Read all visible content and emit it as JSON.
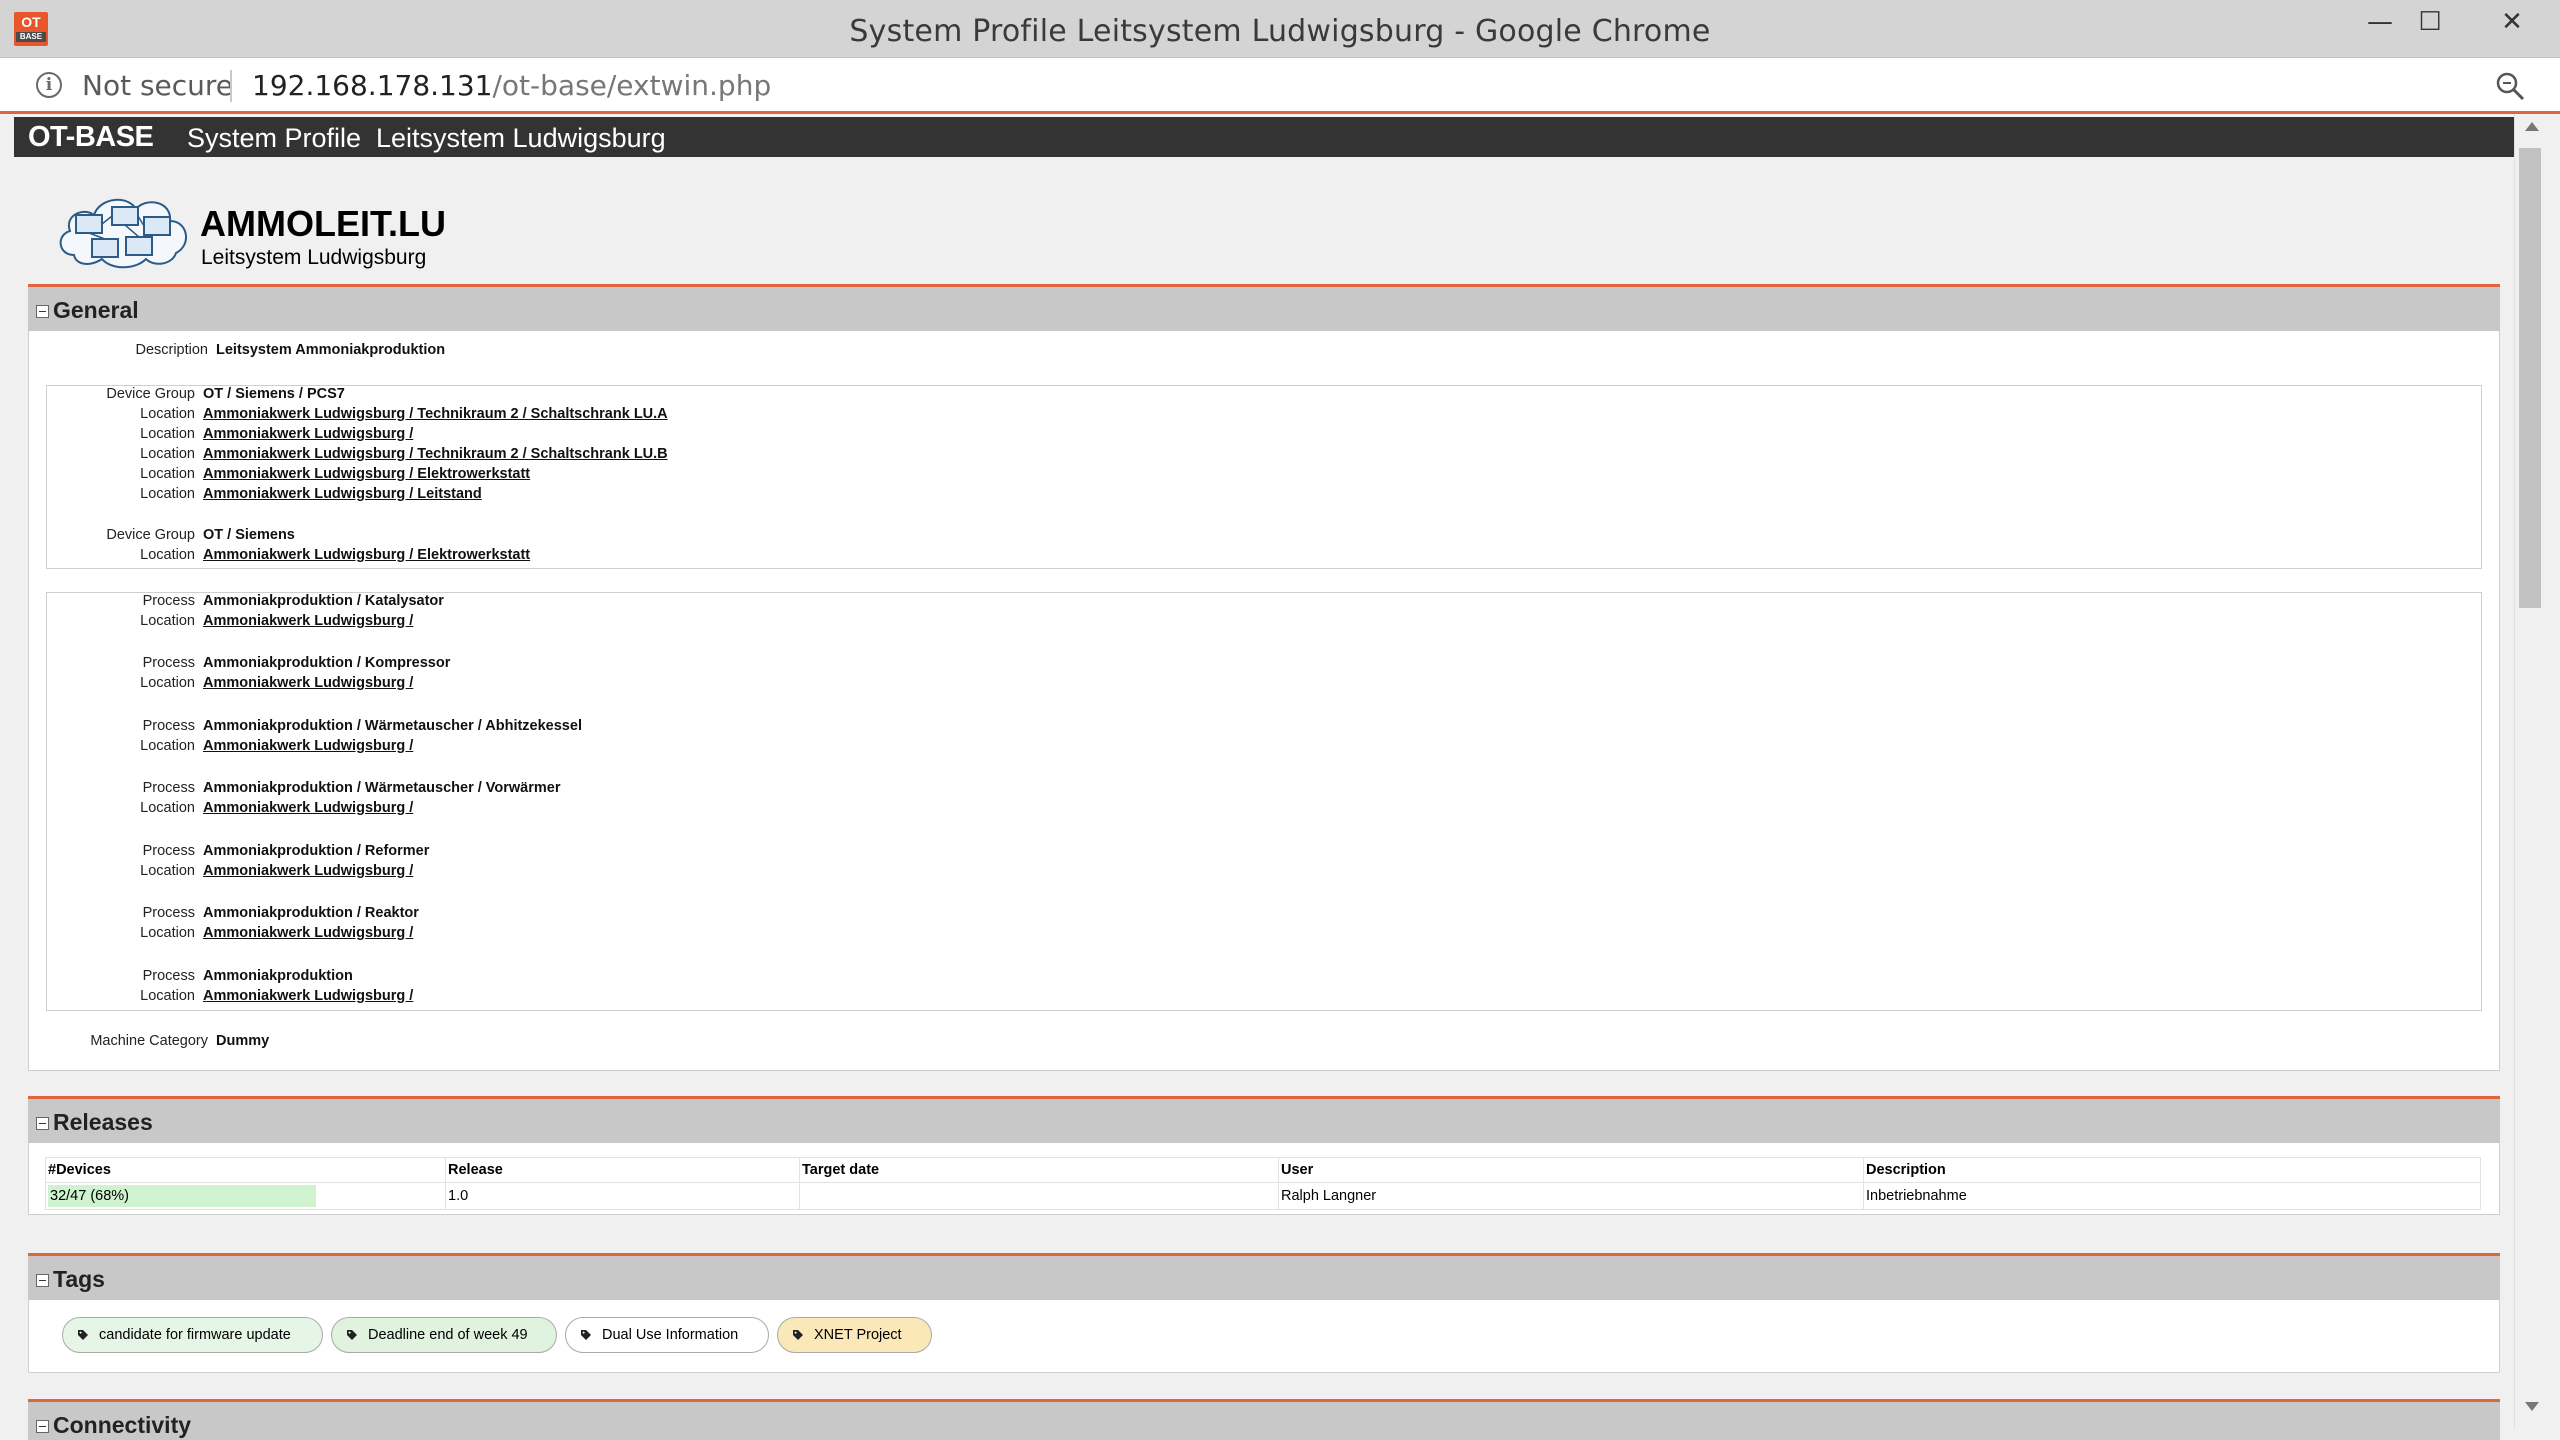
{
  "browser": {
    "window_title": "System Profile Leitsystem Ludwigsburg - Google Chrome",
    "app_icon_text": "OT",
    "app_icon_sub": "BASE",
    "minimize": "—",
    "maximize": "☐",
    "close": "✕",
    "security_label": "Not secure",
    "url_host": "192.168.178.131",
    "url_path": "/ot-base/extwin.php"
  },
  "topbar": {
    "brand": "OT-BASE",
    "crumb_1": "System Profile",
    "crumb_2": "Leitsystem Ludwigsburg"
  },
  "header": {
    "system_name": "AMMOLEIT.LU",
    "system_subtitle": "Leitsystem Ludwigsburg"
  },
  "general": {
    "title": "General",
    "description_label": "Description",
    "description_value": "Leitsystem Ammoniakproduktion",
    "device_groups": [
      {
        "label": "Device Group",
        "value": "OT / Siemens / PCS7",
        "locations": [
          "Ammoniakwerk Ludwigsburg / Technikraum 2 / Schaltschrank LU.A",
          "Ammoniakwerk Ludwigsburg /",
          "Ammoniakwerk Ludwigsburg / Technikraum 2 / Schaltschrank LU.B",
          "Ammoniakwerk Ludwigsburg / Elektrowerkstatt",
          "Ammoniakwerk Ludwigsburg / Leitstand"
        ]
      },
      {
        "label": "Device Group",
        "value": "OT / Siemens",
        "locations": [
          "Ammoniakwerk Ludwigsburg / Elektrowerkstatt"
        ]
      }
    ],
    "location_label": "Location",
    "process_label": "Process",
    "processes": [
      {
        "process": "Ammoniakproduktion / Katalysator",
        "location": "Ammoniakwerk Ludwigsburg /"
      },
      {
        "process": "Ammoniakproduktion / Kompressor",
        "location": "Ammoniakwerk Ludwigsburg /"
      },
      {
        "process": "Ammoniakproduktion / Wärmetauscher / Abhitzekessel",
        "location": "Ammoniakwerk Ludwigsburg /"
      },
      {
        "process": "Ammoniakproduktion / Wärmetauscher / Vorwärmer",
        "location": "Ammoniakwerk Ludwigsburg /"
      },
      {
        "process": "Ammoniakproduktion / Reformer",
        "location": "Ammoniakwerk Ludwigsburg /"
      },
      {
        "process": "Ammoniakproduktion / Reaktor",
        "location": "Ammoniakwerk Ludwigsburg /"
      },
      {
        "process": "Ammoniakproduktion",
        "location": "Ammoniakwerk Ludwigsburg /"
      }
    ],
    "machine_category_label": "Machine Category",
    "machine_category_value": "Dummy"
  },
  "releases": {
    "title": "Releases",
    "columns": [
      "#Devices",
      "Release",
      "Target date",
      "User",
      "Description"
    ],
    "rows": [
      {
        "devices": "32/47 (68%)",
        "devices_fraction": 0.68,
        "release": "1.0",
        "target_date": "",
        "user": "Ralph Langner",
        "description": "Inbetriebnahme"
      }
    ]
  },
  "tags": {
    "title": "Tags",
    "items": [
      {
        "label": "candidate for firmware update",
        "color": "#e6f6e6"
      },
      {
        "label": "Deadline end of week 49",
        "color": "#dff3df"
      },
      {
        "label": "Dual Use Information",
        "color": "#ffffff"
      },
      {
        "label": "XNET Project",
        "color": "#fbe8b8"
      }
    ]
  },
  "connectivity": {
    "title": "Connectivity"
  },
  "colors": {
    "accent": "#e0653d",
    "topbar": "#333333",
    "section_header": "#c8c8c8"
  }
}
